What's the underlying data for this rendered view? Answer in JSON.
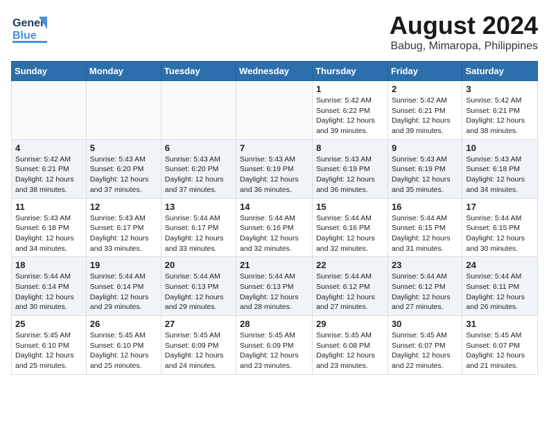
{
  "header": {
    "logo_general": "General",
    "logo_blue": "Blue",
    "month": "August 2024",
    "location": "Babug, Mimaropa, Philippines"
  },
  "weekdays": [
    "Sunday",
    "Monday",
    "Tuesday",
    "Wednesday",
    "Thursday",
    "Friday",
    "Saturday"
  ],
  "weeks": [
    [
      {
        "day": "",
        "info": ""
      },
      {
        "day": "",
        "info": ""
      },
      {
        "day": "",
        "info": ""
      },
      {
        "day": "",
        "info": ""
      },
      {
        "day": "1",
        "info": "Sunrise: 5:42 AM\nSunset: 6:22 PM\nDaylight: 12 hours\nand 39 minutes."
      },
      {
        "day": "2",
        "info": "Sunrise: 5:42 AM\nSunset: 6:21 PM\nDaylight: 12 hours\nand 39 minutes."
      },
      {
        "day": "3",
        "info": "Sunrise: 5:42 AM\nSunset: 6:21 PM\nDaylight: 12 hours\nand 38 minutes."
      }
    ],
    [
      {
        "day": "4",
        "info": "Sunrise: 5:42 AM\nSunset: 6:21 PM\nDaylight: 12 hours\nand 38 minutes."
      },
      {
        "day": "5",
        "info": "Sunrise: 5:43 AM\nSunset: 6:20 PM\nDaylight: 12 hours\nand 37 minutes."
      },
      {
        "day": "6",
        "info": "Sunrise: 5:43 AM\nSunset: 6:20 PM\nDaylight: 12 hours\nand 37 minutes."
      },
      {
        "day": "7",
        "info": "Sunrise: 5:43 AM\nSunset: 6:19 PM\nDaylight: 12 hours\nand 36 minutes."
      },
      {
        "day": "8",
        "info": "Sunrise: 5:43 AM\nSunset: 6:19 PM\nDaylight: 12 hours\nand 36 minutes."
      },
      {
        "day": "9",
        "info": "Sunrise: 5:43 AM\nSunset: 6:19 PM\nDaylight: 12 hours\nand 35 minutes."
      },
      {
        "day": "10",
        "info": "Sunrise: 5:43 AM\nSunset: 6:18 PM\nDaylight: 12 hours\nand 34 minutes."
      }
    ],
    [
      {
        "day": "11",
        "info": "Sunrise: 5:43 AM\nSunset: 6:18 PM\nDaylight: 12 hours\nand 34 minutes."
      },
      {
        "day": "12",
        "info": "Sunrise: 5:43 AM\nSunset: 6:17 PM\nDaylight: 12 hours\nand 33 minutes."
      },
      {
        "day": "13",
        "info": "Sunrise: 5:44 AM\nSunset: 6:17 PM\nDaylight: 12 hours\nand 33 minutes."
      },
      {
        "day": "14",
        "info": "Sunrise: 5:44 AM\nSunset: 6:16 PM\nDaylight: 12 hours\nand 32 minutes."
      },
      {
        "day": "15",
        "info": "Sunrise: 5:44 AM\nSunset: 6:16 PM\nDaylight: 12 hours\nand 32 minutes."
      },
      {
        "day": "16",
        "info": "Sunrise: 5:44 AM\nSunset: 6:15 PM\nDaylight: 12 hours\nand 31 minutes."
      },
      {
        "day": "17",
        "info": "Sunrise: 5:44 AM\nSunset: 6:15 PM\nDaylight: 12 hours\nand 30 minutes."
      }
    ],
    [
      {
        "day": "18",
        "info": "Sunrise: 5:44 AM\nSunset: 6:14 PM\nDaylight: 12 hours\nand 30 minutes."
      },
      {
        "day": "19",
        "info": "Sunrise: 5:44 AM\nSunset: 6:14 PM\nDaylight: 12 hours\nand 29 minutes."
      },
      {
        "day": "20",
        "info": "Sunrise: 5:44 AM\nSunset: 6:13 PM\nDaylight: 12 hours\nand 29 minutes."
      },
      {
        "day": "21",
        "info": "Sunrise: 5:44 AM\nSunset: 6:13 PM\nDaylight: 12 hours\nand 28 minutes."
      },
      {
        "day": "22",
        "info": "Sunrise: 5:44 AM\nSunset: 6:12 PM\nDaylight: 12 hours\nand 27 minutes."
      },
      {
        "day": "23",
        "info": "Sunrise: 5:44 AM\nSunset: 6:12 PM\nDaylight: 12 hours\nand 27 minutes."
      },
      {
        "day": "24",
        "info": "Sunrise: 5:44 AM\nSunset: 6:11 PM\nDaylight: 12 hours\nand 26 minutes."
      }
    ],
    [
      {
        "day": "25",
        "info": "Sunrise: 5:45 AM\nSunset: 6:10 PM\nDaylight: 12 hours\nand 25 minutes."
      },
      {
        "day": "26",
        "info": "Sunrise: 5:45 AM\nSunset: 6:10 PM\nDaylight: 12 hours\nand 25 minutes."
      },
      {
        "day": "27",
        "info": "Sunrise: 5:45 AM\nSunset: 6:09 PM\nDaylight: 12 hours\nand 24 minutes."
      },
      {
        "day": "28",
        "info": "Sunrise: 5:45 AM\nSunset: 6:09 PM\nDaylight: 12 hours\nand 23 minutes."
      },
      {
        "day": "29",
        "info": "Sunrise: 5:45 AM\nSunset: 6:08 PM\nDaylight: 12 hours\nand 23 minutes."
      },
      {
        "day": "30",
        "info": "Sunrise: 5:45 AM\nSunset: 6:07 PM\nDaylight: 12 hours\nand 22 minutes."
      },
      {
        "day": "31",
        "info": "Sunrise: 5:45 AM\nSunset: 6:07 PM\nDaylight: 12 hours\nand 21 minutes."
      }
    ]
  ]
}
